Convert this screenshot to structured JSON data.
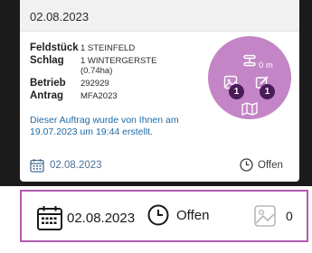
{
  "card": {
    "header_date": "02.08.2023",
    "fields": [
      {
        "label": "Feldstück",
        "value": "1  STEINFELD"
      },
      {
        "label": "Schlag",
        "value": "1  WINTERGERSTE",
        "extra": "(0.74ha)"
      },
      {
        "label": "Betrieb",
        "value": "292929"
      },
      {
        "label": "Antrag",
        "value": "MFA2023"
      }
    ],
    "note": "Dieser Auftrag wurde von Ihnen am 19.07.2023 um 19:44 erstellt.",
    "distance": "0 m",
    "photo_badge": "1",
    "edit_badge": "1",
    "footer_date": "02.08.2023",
    "footer_status": "Offen"
  },
  "bottom_bar": {
    "date": "02.08.2023",
    "status": "Offen",
    "photo_count": "0"
  },
  "colors": {
    "accent": "#c385c6",
    "badge": "#4a1c58",
    "highlight_border": "#b25bb0",
    "note_text": "#1e6aa5"
  },
  "icons": [
    "calendar-icon",
    "clock-icon",
    "image-icon",
    "edit-icon",
    "route-icon",
    "map-icon"
  ]
}
